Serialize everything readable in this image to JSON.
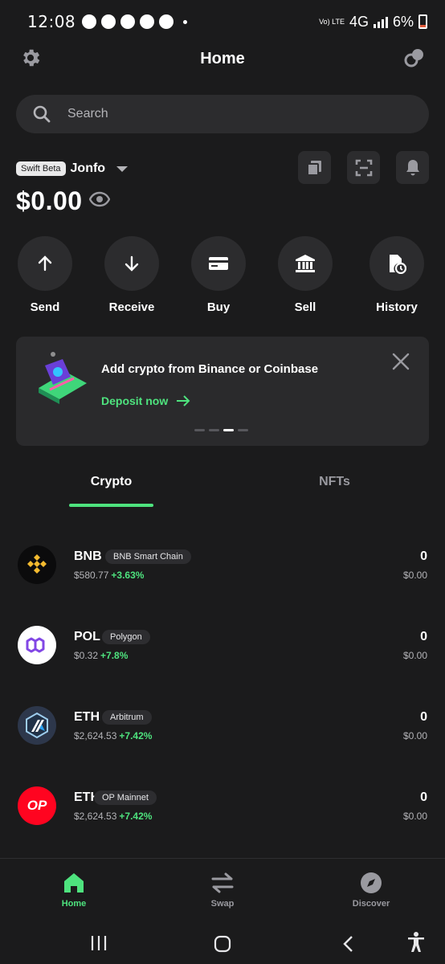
{
  "status_bar": {
    "time": "12:08",
    "network": "4G",
    "lte_label": "Vo) LTE",
    "battery": "6%"
  },
  "header": {
    "title": "Home"
  },
  "search": {
    "placeholder": "Search"
  },
  "wallet": {
    "badge": "Swift Beta",
    "name": "Jonfo",
    "balance": "$0.00"
  },
  "actions": [
    {
      "label": "Send",
      "icon": "arrow-up-icon"
    },
    {
      "label": "Receive",
      "icon": "arrow-down-icon"
    },
    {
      "label": "Buy",
      "icon": "card-icon"
    },
    {
      "label": "Sell",
      "icon": "bank-icon"
    },
    {
      "label": "History",
      "icon": "history-icon"
    }
  ],
  "promo": {
    "title": "Add crypto from Binance or Coinbase",
    "link": "Deposit now",
    "dots_active": 3,
    "dots_total": 4
  },
  "tabs": [
    {
      "label": "Crypto",
      "active": true
    },
    {
      "label": "NFTs",
      "active": false
    }
  ],
  "assets": [
    {
      "symbol": "BNB",
      "network": "BNB Smart Chain",
      "price": "$580.77",
      "change": "+3.63%",
      "amount": "0",
      "value": "$0.00",
      "logo": "bnb-logo"
    },
    {
      "symbol": "POL",
      "network": "Polygon",
      "price": "$0.32",
      "change": "+7.8%",
      "amount": "0",
      "value": "$0.00",
      "logo": "polygon-logo"
    },
    {
      "symbol": "ETH",
      "network": "Arbitrum",
      "price": "$2,624.53",
      "change": "+7.42%",
      "amount": "0",
      "value": "$0.00",
      "logo": "arbitrum-logo"
    },
    {
      "symbol": "ETH",
      "network": "OP Mainnet",
      "price": "$2,624.53",
      "change": "+7.42%",
      "amount": "0",
      "value": "$0.00",
      "logo": "op-logo",
      "logo_text": "OP"
    }
  ],
  "bottom_nav": [
    {
      "label": "Home",
      "active": true
    },
    {
      "label": "Swap",
      "active": false
    },
    {
      "label": "Discover",
      "active": false
    }
  ],
  "colors": {
    "accent": "#4ee37e",
    "background": "#1b1b1c",
    "surface": "#2c2c2e"
  }
}
